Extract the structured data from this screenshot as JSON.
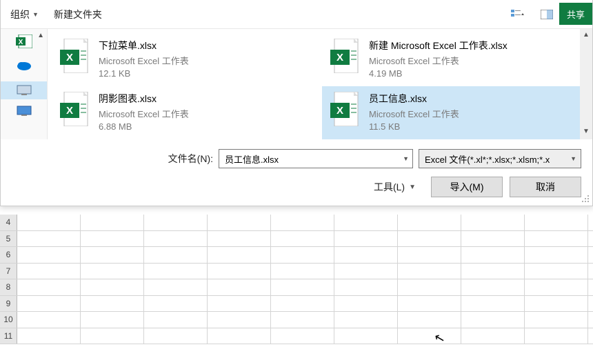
{
  "toolbar": {
    "organize": "组织",
    "new_folder": "新建文件夹",
    "share": "共享"
  },
  "nav": {
    "items": [
      "excel-icon",
      "onedrive-icon",
      "thispc-icon",
      "network-icon"
    ]
  },
  "files": [
    {
      "name": "下拉菜单.xlsx",
      "type": "Microsoft Excel 工作表",
      "size": "12.1 KB",
      "selected": false
    },
    {
      "name": "新建 Microsoft Excel 工作表.xlsx",
      "type": "Microsoft Excel 工作表",
      "size": "4.19 MB",
      "selected": false
    },
    {
      "name": "阴影图表.xlsx",
      "type": "Microsoft Excel 工作表",
      "size": "6.88 MB",
      "selected": false
    },
    {
      "name": "员工信息.xlsx",
      "type": "Microsoft Excel 工作表",
      "size": "11.5 KB",
      "selected": true
    }
  ],
  "filename": {
    "label": "文件名(N):",
    "value": "员工信息.xlsx"
  },
  "filter": {
    "text": "Excel 文件(*.xl*;*.xlsx;*.xlsm;*.x"
  },
  "tools": {
    "label": "工具(L)"
  },
  "buttons": {
    "import": "导入(M)",
    "cancel": "取消"
  },
  "rows": [
    4,
    5,
    6,
    7,
    8,
    9,
    10,
    11
  ],
  "colors": {
    "excel_green": "#107c41",
    "accent": "#0078d7"
  }
}
